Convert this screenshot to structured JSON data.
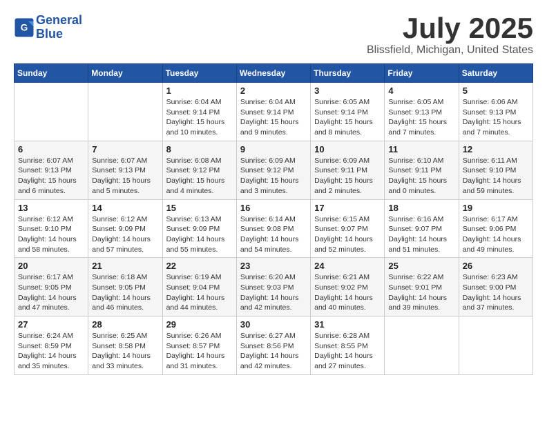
{
  "header": {
    "logo_line1": "General",
    "logo_line2": "Blue",
    "month_title": "July 2025",
    "location": "Blissfield, Michigan, United States"
  },
  "weekdays": [
    "Sunday",
    "Monday",
    "Tuesday",
    "Wednesday",
    "Thursday",
    "Friday",
    "Saturday"
  ],
  "weeks": [
    [
      {
        "day": "",
        "sunrise": "",
        "sunset": "",
        "daylight": ""
      },
      {
        "day": "",
        "sunrise": "",
        "sunset": "",
        "daylight": ""
      },
      {
        "day": "1",
        "sunrise": "Sunrise: 6:04 AM",
        "sunset": "Sunset: 9:14 PM",
        "daylight": "Daylight: 15 hours and 10 minutes."
      },
      {
        "day": "2",
        "sunrise": "Sunrise: 6:04 AM",
        "sunset": "Sunset: 9:14 PM",
        "daylight": "Daylight: 15 hours and 9 minutes."
      },
      {
        "day": "3",
        "sunrise": "Sunrise: 6:05 AM",
        "sunset": "Sunset: 9:14 PM",
        "daylight": "Daylight: 15 hours and 8 minutes."
      },
      {
        "day": "4",
        "sunrise": "Sunrise: 6:05 AM",
        "sunset": "Sunset: 9:13 PM",
        "daylight": "Daylight: 15 hours and 7 minutes."
      },
      {
        "day": "5",
        "sunrise": "Sunrise: 6:06 AM",
        "sunset": "Sunset: 9:13 PM",
        "daylight": "Daylight: 15 hours and 7 minutes."
      }
    ],
    [
      {
        "day": "6",
        "sunrise": "Sunrise: 6:07 AM",
        "sunset": "Sunset: 9:13 PM",
        "daylight": "Daylight: 15 hours and 6 minutes."
      },
      {
        "day": "7",
        "sunrise": "Sunrise: 6:07 AM",
        "sunset": "Sunset: 9:13 PM",
        "daylight": "Daylight: 15 hours and 5 minutes."
      },
      {
        "day": "8",
        "sunrise": "Sunrise: 6:08 AM",
        "sunset": "Sunset: 9:12 PM",
        "daylight": "Daylight: 15 hours and 4 minutes."
      },
      {
        "day": "9",
        "sunrise": "Sunrise: 6:09 AM",
        "sunset": "Sunset: 9:12 PM",
        "daylight": "Daylight: 15 hours and 3 minutes."
      },
      {
        "day": "10",
        "sunrise": "Sunrise: 6:09 AM",
        "sunset": "Sunset: 9:11 PM",
        "daylight": "Daylight: 15 hours and 2 minutes."
      },
      {
        "day": "11",
        "sunrise": "Sunrise: 6:10 AM",
        "sunset": "Sunset: 9:11 PM",
        "daylight": "Daylight: 15 hours and 0 minutes."
      },
      {
        "day": "12",
        "sunrise": "Sunrise: 6:11 AM",
        "sunset": "Sunset: 9:10 PM",
        "daylight": "Daylight: 14 hours and 59 minutes."
      }
    ],
    [
      {
        "day": "13",
        "sunrise": "Sunrise: 6:12 AM",
        "sunset": "Sunset: 9:10 PM",
        "daylight": "Daylight: 14 hours and 58 minutes."
      },
      {
        "day": "14",
        "sunrise": "Sunrise: 6:12 AM",
        "sunset": "Sunset: 9:09 PM",
        "daylight": "Daylight: 14 hours and 57 minutes."
      },
      {
        "day": "15",
        "sunrise": "Sunrise: 6:13 AM",
        "sunset": "Sunset: 9:09 PM",
        "daylight": "Daylight: 14 hours and 55 minutes."
      },
      {
        "day": "16",
        "sunrise": "Sunrise: 6:14 AM",
        "sunset": "Sunset: 9:08 PM",
        "daylight": "Daylight: 14 hours and 54 minutes."
      },
      {
        "day": "17",
        "sunrise": "Sunrise: 6:15 AM",
        "sunset": "Sunset: 9:07 PM",
        "daylight": "Daylight: 14 hours and 52 minutes."
      },
      {
        "day": "18",
        "sunrise": "Sunrise: 6:16 AM",
        "sunset": "Sunset: 9:07 PM",
        "daylight": "Daylight: 14 hours and 51 minutes."
      },
      {
        "day": "19",
        "sunrise": "Sunrise: 6:17 AM",
        "sunset": "Sunset: 9:06 PM",
        "daylight": "Daylight: 14 hours and 49 minutes."
      }
    ],
    [
      {
        "day": "20",
        "sunrise": "Sunrise: 6:17 AM",
        "sunset": "Sunset: 9:05 PM",
        "daylight": "Daylight: 14 hours and 47 minutes."
      },
      {
        "day": "21",
        "sunrise": "Sunrise: 6:18 AM",
        "sunset": "Sunset: 9:05 PM",
        "daylight": "Daylight: 14 hours and 46 minutes."
      },
      {
        "day": "22",
        "sunrise": "Sunrise: 6:19 AM",
        "sunset": "Sunset: 9:04 PM",
        "daylight": "Daylight: 14 hours and 44 minutes."
      },
      {
        "day": "23",
        "sunrise": "Sunrise: 6:20 AM",
        "sunset": "Sunset: 9:03 PM",
        "daylight": "Daylight: 14 hours and 42 minutes."
      },
      {
        "day": "24",
        "sunrise": "Sunrise: 6:21 AM",
        "sunset": "Sunset: 9:02 PM",
        "daylight": "Daylight: 14 hours and 40 minutes."
      },
      {
        "day": "25",
        "sunrise": "Sunrise: 6:22 AM",
        "sunset": "Sunset: 9:01 PM",
        "daylight": "Daylight: 14 hours and 39 minutes."
      },
      {
        "day": "26",
        "sunrise": "Sunrise: 6:23 AM",
        "sunset": "Sunset: 9:00 PM",
        "daylight": "Daylight: 14 hours and 37 minutes."
      }
    ],
    [
      {
        "day": "27",
        "sunrise": "Sunrise: 6:24 AM",
        "sunset": "Sunset: 8:59 PM",
        "daylight": "Daylight: 14 hours and 35 minutes."
      },
      {
        "day": "28",
        "sunrise": "Sunrise: 6:25 AM",
        "sunset": "Sunset: 8:58 PM",
        "daylight": "Daylight: 14 hours and 33 minutes."
      },
      {
        "day": "29",
        "sunrise": "Sunrise: 6:26 AM",
        "sunset": "Sunset: 8:57 PM",
        "daylight": "Daylight: 14 hours and 31 minutes."
      },
      {
        "day": "30",
        "sunrise": "Sunrise: 6:27 AM",
        "sunset": "Sunset: 8:56 PM",
        "daylight": "Daylight: 14 hours and 42 minutes."
      },
      {
        "day": "31",
        "sunrise": "Sunrise: 6:28 AM",
        "sunset": "Sunset: 8:55 PM",
        "daylight": "Daylight: 14 hours and 27 minutes."
      },
      {
        "day": "",
        "sunrise": "",
        "sunset": "",
        "daylight": ""
      },
      {
        "day": "",
        "sunrise": "",
        "sunset": "",
        "daylight": ""
      }
    ]
  ]
}
